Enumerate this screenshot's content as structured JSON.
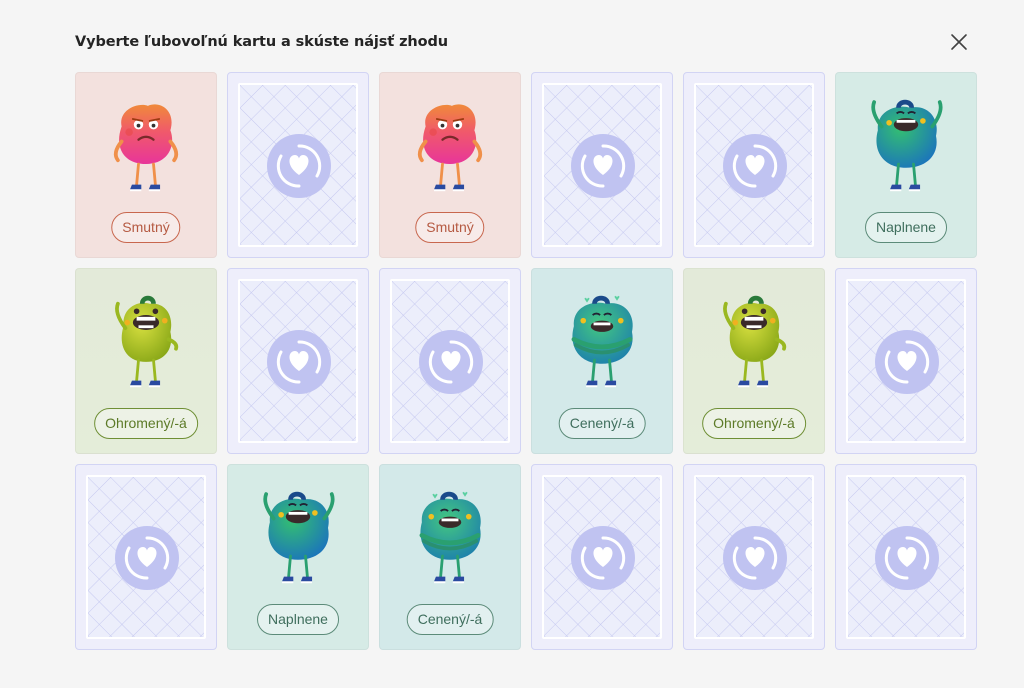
{
  "header": {
    "title": "Vyberte ľubovoľnú kartu a skúste nájsť zhodu",
    "close_icon": "close-icon"
  },
  "colors": {
    "card_back": "#eeeefb",
    "card_back_pattern": "#c6c9f0",
    "card_back_emblem": "#c0c3f1",
    "sad_bg": "#f3e1de",
    "amazed_bg": "#e3ead9",
    "fulfilled_bg": "#d6ebe6",
    "appreciated_bg": "#d3e9e9"
  },
  "cards": [
    {
      "state": "face",
      "emotion": "sad",
      "label": "Smutný",
      "icon": "sad-monster-icon"
    },
    {
      "state": "back",
      "icon": "heart-emblem-icon"
    },
    {
      "state": "face",
      "emotion": "sad",
      "label": "Smutný",
      "icon": "sad-monster-icon"
    },
    {
      "state": "back",
      "icon": "heart-emblem-icon"
    },
    {
      "state": "back",
      "icon": "heart-emblem-icon"
    },
    {
      "state": "face",
      "emotion": "fulfilled",
      "label": "Naplnene",
      "icon": "fulfilled-monster-icon"
    },
    {
      "state": "face",
      "emotion": "amazed",
      "label": "Ohromený/-á",
      "icon": "amazed-monster-icon"
    },
    {
      "state": "back",
      "icon": "heart-emblem-icon"
    },
    {
      "state": "back",
      "icon": "heart-emblem-icon"
    },
    {
      "state": "face",
      "emotion": "appreciated",
      "label": "Cenený/-á",
      "icon": "appreciated-monster-icon"
    },
    {
      "state": "face",
      "emotion": "amazed",
      "label": "Ohromený/-á",
      "icon": "amazed-monster-icon"
    },
    {
      "state": "back",
      "icon": "heart-emblem-icon"
    },
    {
      "state": "back",
      "icon": "heart-emblem-icon"
    },
    {
      "state": "face",
      "emotion": "fulfilled",
      "label": "Naplnene",
      "icon": "fulfilled-monster-icon"
    },
    {
      "state": "face",
      "emotion": "appreciated",
      "label": "Cenený/-á",
      "icon": "appreciated-monster-icon"
    },
    {
      "state": "back",
      "icon": "heart-emblem-icon"
    },
    {
      "state": "back",
      "icon": "heart-emblem-icon"
    },
    {
      "state": "back",
      "icon": "heart-emblem-icon"
    }
  ]
}
